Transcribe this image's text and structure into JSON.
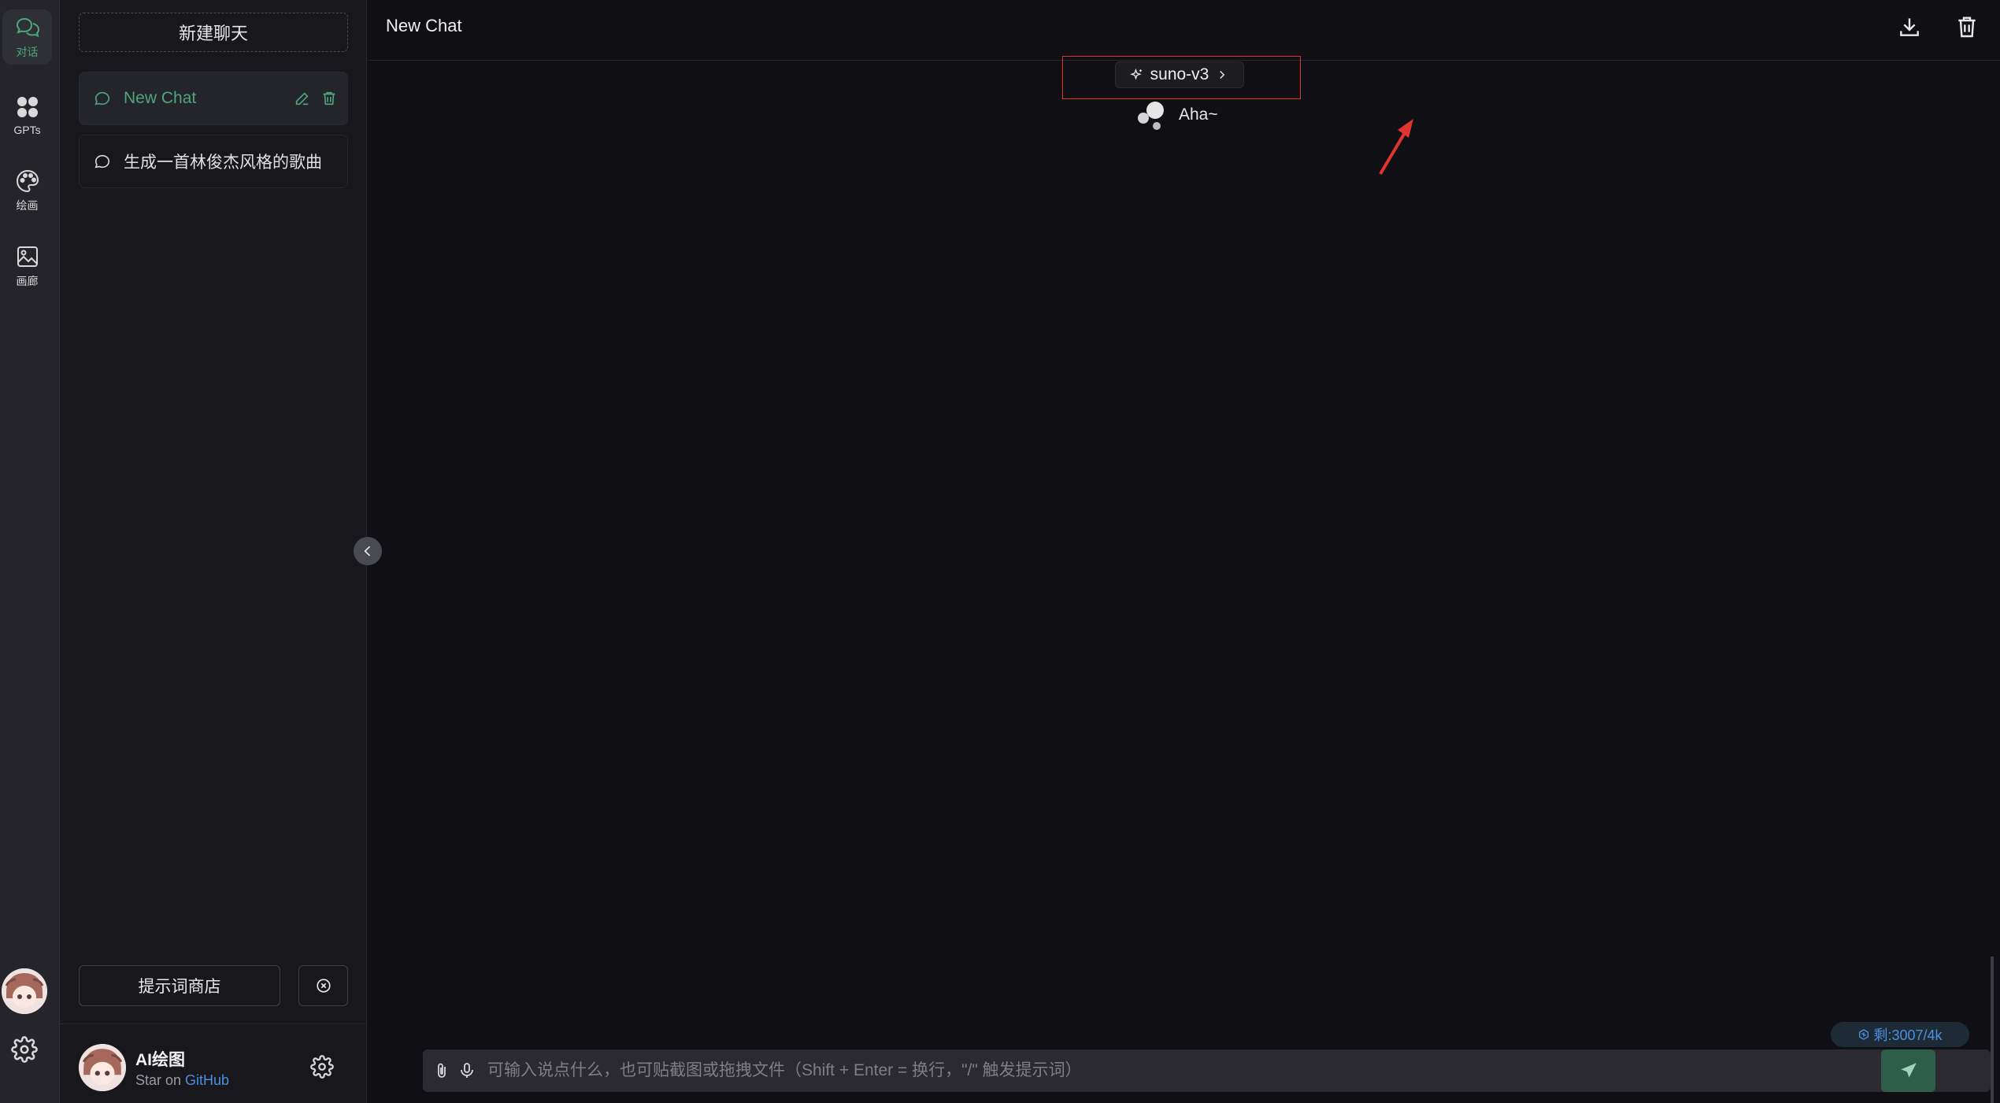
{
  "rail": {
    "items": [
      {
        "label": "对话",
        "icon": "chat-bubbles-icon",
        "active": true
      },
      {
        "label": "GPTs",
        "icon": "apps-grid-icon",
        "active": false
      },
      {
        "label": "绘画",
        "icon": "palette-icon",
        "active": false
      },
      {
        "label": "画廊",
        "icon": "gallery-image-icon",
        "active": false
      }
    ],
    "settings_icon": "gear-icon"
  },
  "sidebar": {
    "new_chat_label": "新建聊天",
    "conversations": [
      {
        "title": "New Chat",
        "active": true
      },
      {
        "title": "生成一首林俊杰风格的歌曲",
        "active": false
      }
    ],
    "prompt_store_label": "提示词商店",
    "user": {
      "name": "AI绘图",
      "sub_prefix": "Star on ",
      "sub_link": "GitHub"
    }
  },
  "header": {
    "title": "New Chat",
    "download_icon": "download-icon",
    "delete_icon": "trash-icon"
  },
  "chat": {
    "model_name": "suno-v3",
    "greeting": "Aha~"
  },
  "footer": {
    "token_badge": "剩:3007/4k",
    "input_placeholder": "可输入说点什么，也可贴截图或拖拽文件（Shift + Enter = 换行，\"/\" 触发提示词）"
  },
  "colors": {
    "accent": "#4ea67a",
    "highlight_box": "#e0342f",
    "link": "#4a8fe0",
    "background": "#101014"
  }
}
